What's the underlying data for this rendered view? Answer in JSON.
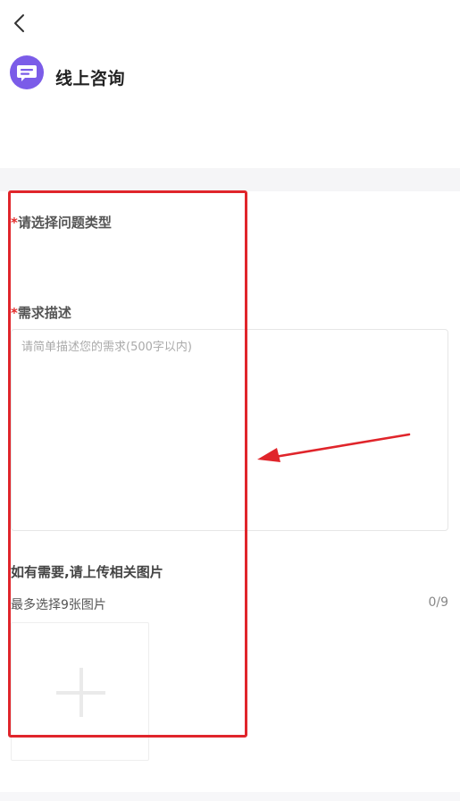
{
  "header": {
    "title": "线上咨询",
    "back_icon": "chevron-left-icon",
    "app_icon": "message-icon",
    "app_icon_color": "#7b5ce8"
  },
  "form": {
    "required_mark": "*",
    "type_label": "请选择问题类型",
    "desc_label": "需求描述",
    "desc_placeholder": "请简单描述您的需求(500字以内)",
    "desc_value": ""
  },
  "upload": {
    "title": "如有需要,请上传相关图片",
    "hint": "最多选择9张图片",
    "count": "0/9",
    "add_icon": "plus-icon"
  },
  "annotation": {
    "box_color": "#e0252b",
    "arrow_color": "#e0252b"
  }
}
